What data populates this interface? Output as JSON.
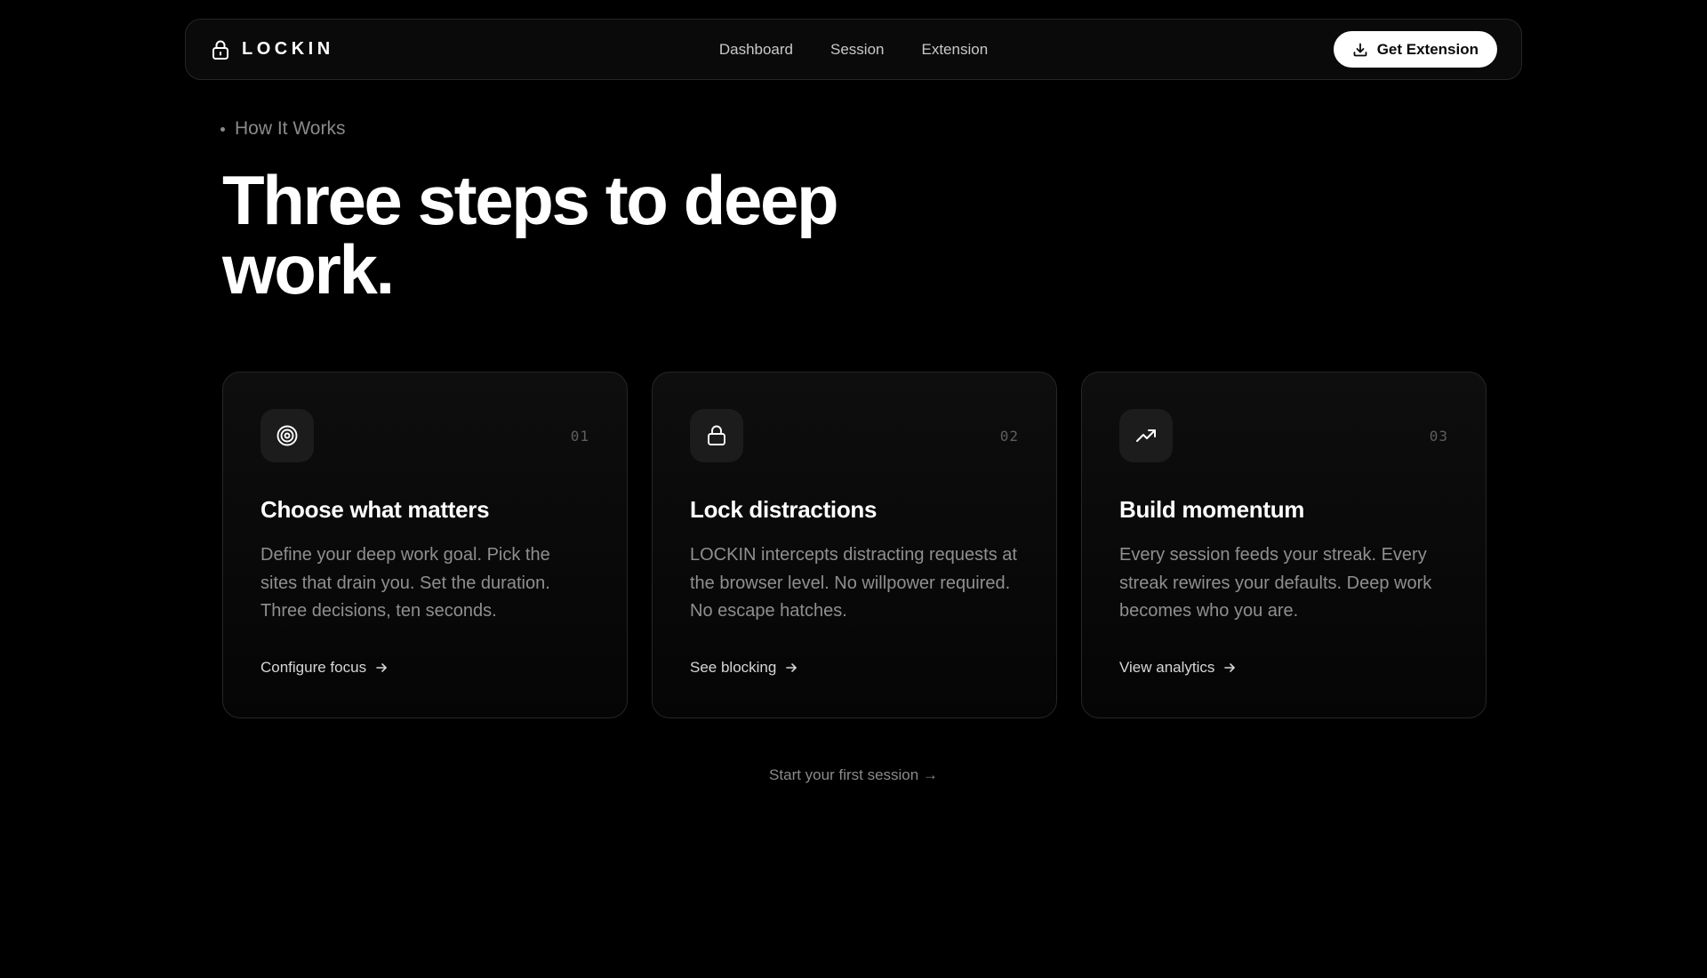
{
  "nav": {
    "brand": "LOCKIN",
    "brand_icon": "lock-icon",
    "links": [
      "Dashboard",
      "Session",
      "Extension"
    ],
    "cta_label": "Get Extension",
    "cta_icon": "download-icon"
  },
  "hero": {
    "eyebrow": "How It Works",
    "headline": "Three steps to deep work."
  },
  "steps": [
    {
      "number": "01",
      "icon": "target-icon",
      "title": "Choose what matters",
      "description": "Define your deep work goal. Pick the sites that drain you. Set the duration. Three decisions, ten seconds.",
      "link": "Configure focus"
    },
    {
      "number": "02",
      "icon": "lock-icon",
      "title": "Lock distractions",
      "description": "LOCKIN intercepts distracting requests at the browser level. No willpower required. No escape hatches.",
      "link": "See blocking"
    },
    {
      "number": "03",
      "icon": "trending-up-icon",
      "title": "Build momentum",
      "description": "Every session feeds your streak. Every streak rewires your defaults. Deep work becomes who you are.",
      "link": "View analytics"
    }
  ],
  "footer": {
    "cta": "Start your first session →"
  },
  "colors": {
    "background": "#000000",
    "card_border": "#262626",
    "muted_text": "#8f8f8f",
    "button_bg": "#ffffff"
  }
}
